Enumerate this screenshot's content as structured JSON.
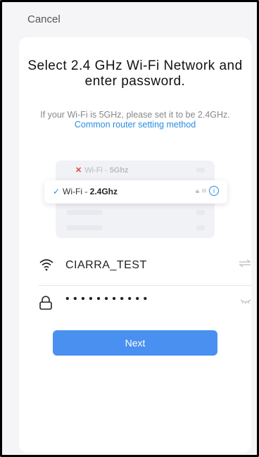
{
  "header": {
    "cancel_label": "Cancel"
  },
  "main": {
    "title": "Select 2.4 GHz Wi-Fi Network and enter password.",
    "subtitle_plain": "If your Wi-Fi is 5GHz, please set it to be 2.4GHz.",
    "subtitle_link": "Common router setting method"
  },
  "illustration": {
    "row_5g_prefix": "Wi-Fi - ",
    "row_5g_band": "5Ghz",
    "row_24_prefix": "Wi-Fi - ",
    "row_24_band": "2.4Ghz"
  },
  "form": {
    "network_name": "CIARRA_TEST",
    "password_mask": "• • • • • • • • • • •",
    "next_label": "Next"
  },
  "icons": {
    "wifi": "wifi-icon",
    "lock": "lock-icon",
    "switch": "switch-arrows-icon",
    "eye": "eye-closed-icon",
    "check": "check-icon",
    "cross": "cross-icon",
    "info": "info-icon"
  },
  "colors": {
    "accent": "#2a8de0",
    "button": "#4a90f0",
    "error": "#e0453a"
  }
}
